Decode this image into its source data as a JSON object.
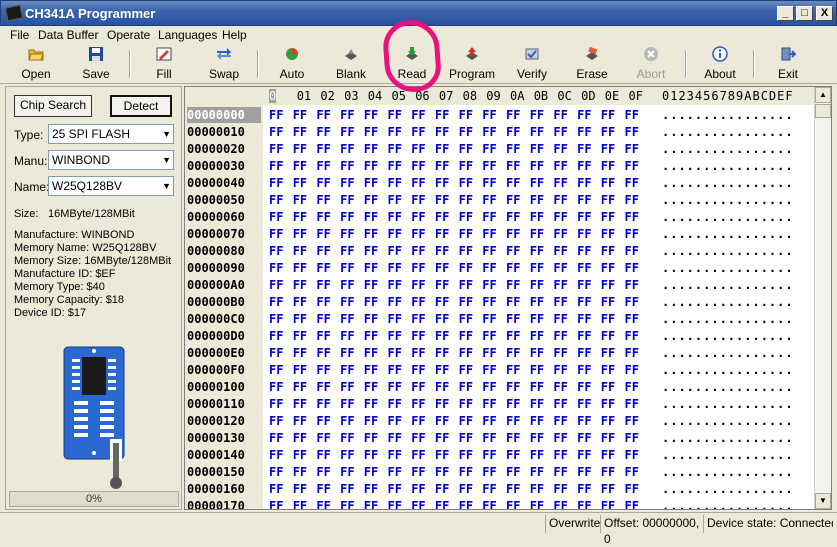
{
  "window": {
    "title": "CH341A Programmer",
    "min": "_",
    "max": "□",
    "close": "X"
  },
  "menu": [
    "File",
    "Data Buffer",
    "Operate",
    "Languages",
    "Help"
  ],
  "toolbar": [
    {
      "label": "Open",
      "icon": "folder-open-icon"
    },
    {
      "label": "Save",
      "icon": "floppy-icon"
    },
    {
      "label": "Fill",
      "icon": "fill-icon"
    },
    {
      "label": "Swap",
      "icon": "swap-arrows-icon"
    },
    {
      "label": "Auto",
      "icon": "auto-icon"
    },
    {
      "label": "Blank",
      "icon": "blank-chip-icon"
    },
    {
      "label": "Read",
      "icon": "read-chip-icon"
    },
    {
      "label": "Program",
      "icon": "program-chip-icon"
    },
    {
      "label": "Verify",
      "icon": "verify-icon"
    },
    {
      "label": "Erase",
      "icon": "erase-icon"
    },
    {
      "label": "Abort",
      "icon": "abort-icon",
      "disabled": true
    },
    {
      "label": "About",
      "icon": "info-icon"
    },
    {
      "label": "Exit",
      "icon": "exit-icon"
    }
  ],
  "left": {
    "chip_search": "Chip Search",
    "detect": "Detect",
    "type_label": "Type:",
    "type_value": "25 SPI FLASH",
    "manu_label": "Manu:",
    "manu_value": "WINBOND",
    "name_label": "Name:",
    "name_value": "W25Q128BV",
    "size_label": "Size:",
    "size_value": "16MByte/128MBit",
    "info": [
      "Manufacture: WINBOND",
      "Memory Name: W25Q128BV",
      "Memory Size: 16MByte/128MBit",
      "Manufacture ID: $EF",
      "Memory Type: $40",
      "Memory Capacity: $18",
      "Device ID: $17"
    ],
    "progress_text": "0%",
    "progress_value": 0
  },
  "hex": {
    "columns": [
      "0",
      "01",
      "02",
      "03",
      "04",
      "05",
      "06",
      "07",
      "08",
      "09",
      "0A",
      "0B",
      "0C",
      "0D",
      "0E",
      "0F"
    ],
    "ascii_header": "0123456789ABCDEF",
    "rows": [
      "00000000",
      "00000010",
      "00000020",
      "00000030",
      "00000040",
      "00000050",
      "00000060",
      "00000070",
      "00000080",
      "00000090",
      "000000A0",
      "000000B0",
      "000000C0",
      "000000D0",
      "000000E0",
      "000000F0",
      "00000100",
      "00000110",
      "00000120",
      "00000130",
      "00000140",
      "00000150",
      "00000160",
      "00000170"
    ],
    "byte": "FF",
    "ascii_row": "................"
  },
  "status": {
    "mode": "Overwrite",
    "offset": "Offset: 00000000, 0",
    "device": "Device state: Connected."
  },
  "colors": {
    "accent": "#2a52a0",
    "hex_bytes": "#0000d0",
    "annotation": "#e8127c"
  }
}
